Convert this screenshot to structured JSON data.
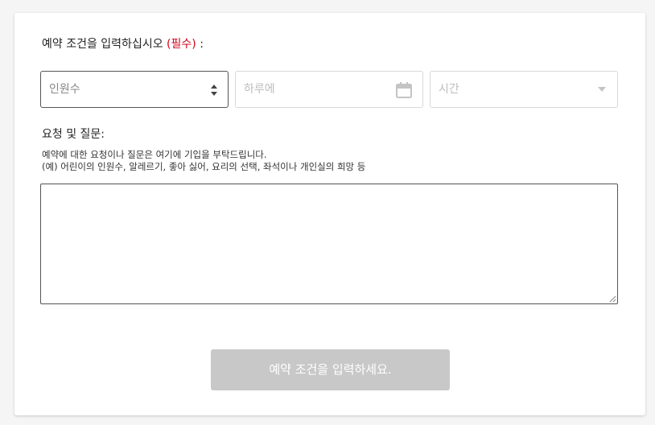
{
  "form": {
    "heading": "예약 조건을 입력하십시오",
    "required_text": "(필수)",
    "heading_colon": ":",
    "people_placeholder": "인원수",
    "date_placeholder": "하루에",
    "time_placeholder": "시간",
    "questions_title": "요청 및 질문:",
    "help_line1": "예약에 대한 요청이나 질문은 여기에 기입을 부탁드립니다.",
    "help_line2": "(예) 어린이의 인원수, 알레르기, 좋아 싫어, 요리의 선택, 좌석이나 개인실의 희망 등",
    "textarea_value": "",
    "submit_label": "예약 조건을 입력하세요."
  },
  "icons": {
    "people": "updown-arrows-icon",
    "date": "calendar-icon",
    "time": "dropdown-caret-icon"
  },
  "colors": {
    "required": "#d0021b",
    "button_disabled": "#c8c8c8"
  }
}
